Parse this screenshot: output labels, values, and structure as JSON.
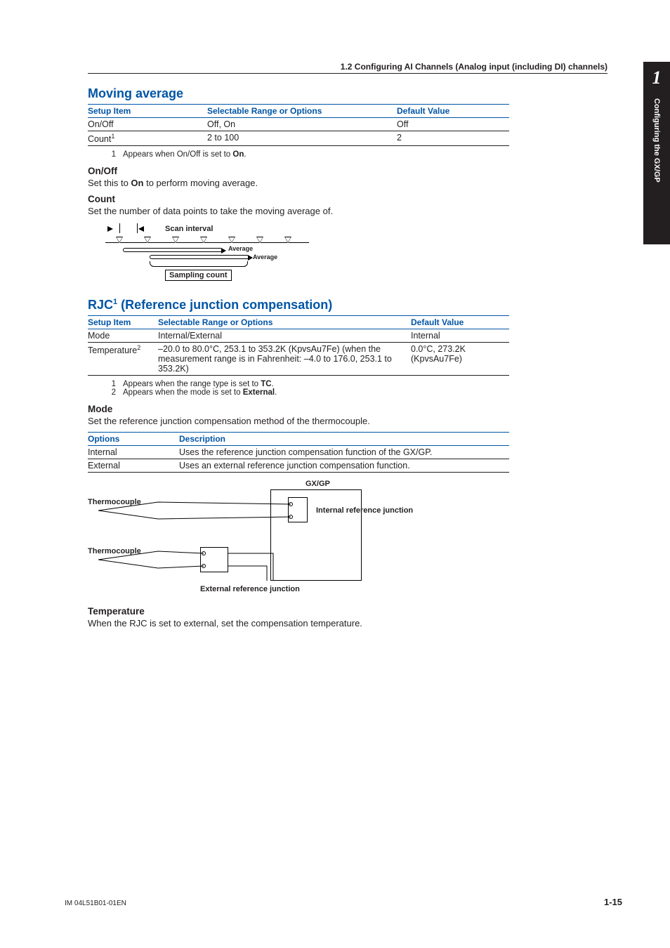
{
  "runningHead": "1.2  Configuring AI Channels (Analog input (including DI) channels)",
  "sideTab": {
    "chapter": "1",
    "label": "Configuring the GX/GP"
  },
  "movingAverage": {
    "title": "Moving average",
    "headers": {
      "item": "Setup Item",
      "range": "Selectable Range or Options",
      "def": "Default Value"
    },
    "rows": [
      {
        "item": "On/Off",
        "sup": "",
        "range": "Off, On",
        "def": "Off"
      },
      {
        "item": "Count",
        "sup": "1",
        "range": "2 to 100",
        "def": "2"
      }
    ],
    "footnotes": [
      {
        "num": "1",
        "text": "Appears when On/Off is set to ",
        "bold": "On",
        "tail": "."
      }
    ],
    "onoff": {
      "head": "On/Off",
      "pre": "Set this to ",
      "bold": "On",
      "post": " to perform moving average."
    },
    "count": {
      "head": "Count",
      "text": "Set the number of data points to take the moving average of."
    },
    "diagram": {
      "scan": "Scan interval",
      "avg": "Average",
      "sampling": "Sampling count"
    }
  },
  "rjc": {
    "title_pre": "RJC",
    "title_sup": "1",
    "title_post": " (Reference junction compensation)",
    "headers": {
      "item": "Setup Item",
      "range": "Selectable Range or Options",
      "def": "Default Value"
    },
    "rows": [
      {
        "item": "Mode",
        "sup": "",
        "range": "Internal/External",
        "def": "Internal"
      },
      {
        "item": "Temperature",
        "sup": "2",
        "range": "–20.0 to 80.0°C, 253.1 to 353.2K (KpvsAu7Fe) (when the measurement range is in Fahrenheit: –4.0 to 176.0, 253.1 to 353.2K)",
        "def": "0.0°C, 273.2K (KpvsAu7Fe)"
      }
    ],
    "footnotes": [
      {
        "num": "1",
        "text": "Appears when the range type is set to ",
        "bold": "TC",
        "tail": "."
      },
      {
        "num": "2",
        "text": "Appears when the mode is set to ",
        "bold": "External",
        "tail": "."
      }
    ],
    "mode": {
      "head": "Mode",
      "lead": "Set the reference junction compensation method of the thermocouple.",
      "optHeaders": {
        "opt": "Options",
        "desc": "Description"
      },
      "opts": [
        {
          "opt": "Internal",
          "desc": "Uses the reference junction compensation function of the GX/GP."
        },
        {
          "opt": "External",
          "desc": "Uses an external reference junction compensation function."
        }
      ]
    },
    "diagram": {
      "gxgp": "GX/GP",
      "tc": "Thermocouple",
      "irj": "Internal reference junction",
      "erj": "External reference junction"
    },
    "temperature": {
      "head": "Temperature",
      "text": "When the RJC is set to external, set the compensation temperature."
    }
  },
  "footer": {
    "left": "IM 04L51B01-01EN",
    "right": "1-15"
  }
}
